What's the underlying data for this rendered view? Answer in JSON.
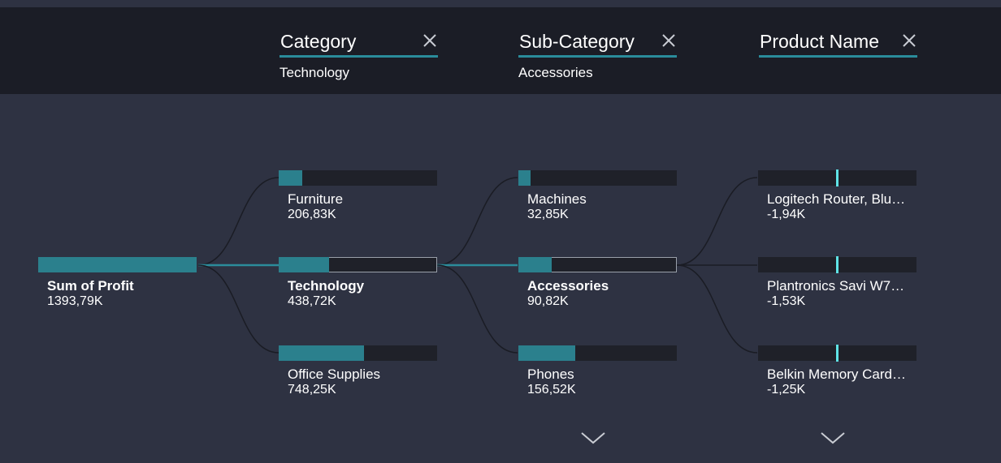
{
  "colors": {
    "background": "#2e3242",
    "header_bg": "#1b1d26",
    "accent": "#2b808d",
    "bar_track": "#1f2129",
    "marker": "#5fe3e6"
  },
  "header": {
    "levels": [
      {
        "title": "Category",
        "value": "Technology",
        "close_icon": "close-icon"
      },
      {
        "title": "Sub-Category",
        "value": "Accessories",
        "close_icon": "close-icon"
      },
      {
        "title": "Product Name",
        "value": "",
        "close_icon": "close-icon"
      }
    ]
  },
  "tree": {
    "root": {
      "label": "Sum of Profit",
      "value": "1393,79K",
      "fill_fraction": 1.0
    },
    "category": [
      {
        "label": "Furniture",
        "value": "206,83K",
        "fill_fraction": 0.148
      },
      {
        "label": "Technology",
        "value": "438,72K",
        "fill_fraction": 0.315,
        "selected": true
      },
      {
        "label": "Office Supplies",
        "value": "748,25K",
        "fill_fraction": 0.537
      }
    ],
    "sub_category": [
      {
        "label": "Machines",
        "value": "32,85K",
        "fill_fraction": 0.075
      },
      {
        "label": "Accessories",
        "value": "90,82K",
        "fill_fraction": 0.207,
        "selected": true
      },
      {
        "label": "Phones",
        "value": "156,52K",
        "fill_fraction": 0.357
      }
    ],
    "product_name": [
      {
        "label": "Logitech Router, Blu…",
        "value": "-1,94K"
      },
      {
        "label": "Plantronics Savi W7…",
        "value": "-1,53K"
      },
      {
        "label": "Belkin Memory Card…",
        "value": "-1,25K"
      }
    ],
    "more_icons": [
      "chevron-down-icon",
      "chevron-down-icon"
    ]
  }
}
